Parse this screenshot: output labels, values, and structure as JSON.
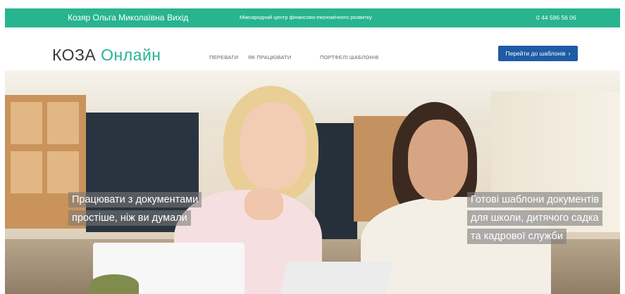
{
  "topbar": {
    "user_name": "Козяр Ольга Миколаївна",
    "logout": "Вихід",
    "organization": "Міжнародний центр фінансово-економічного розвитку",
    "phone": "0 44 586 56 06",
    "color": "#27b48e"
  },
  "nav": {
    "logo_part1": "КОЗА",
    "logo_part2": "Онлайн",
    "menu": [
      "ПЕРЕВАГИ",
      "ЯК ПРАЦЮВАТИ",
      "ПОРТФЕЛІ ШАБЛОНІВ"
    ],
    "cta_label": "Перейти до шаблонів",
    "cta_icon": "chevron-right-icon",
    "cta_color": "#1f5ba6"
  },
  "hero": {
    "left_caption": [
      "Працювати з документами",
      "простіше, ніж ви думали"
    ],
    "right_caption": [
      "Готові шаблони документів",
      "для школи, дитячого садка",
      "та кадрової служби"
    ]
  }
}
